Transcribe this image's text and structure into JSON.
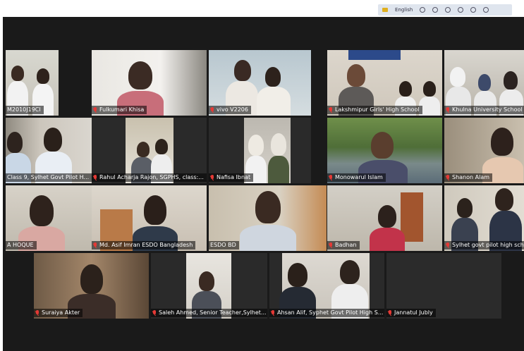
{
  "taskbar": {
    "language": "English"
  },
  "participants": [
    {
      "name": "M2010J19CI"
    },
    {
      "name": "Fulkumari Khisa"
    },
    {
      "name": "vivo V2206"
    },
    {
      "name": "Lakshmipur Girls' High School"
    },
    {
      "name": "Khulna University School"
    },
    {
      "name": "Class 9, Sylhet Govt Pilot H..."
    },
    {
      "name": "Rahul Acharja Rajon, SGPHS, class:..."
    },
    {
      "name": "Nafisa Ibnat"
    },
    {
      "name": "Monowarul Islam"
    },
    {
      "name": "Shanon Alam"
    },
    {
      "name": "A HOQUE"
    },
    {
      "name": "Md. Asif Imran ESDO Bangladesh"
    },
    {
      "name": "ESDO BD"
    },
    {
      "name": "Badhan"
    },
    {
      "name": "Sylhet govt pilot high sch"
    },
    {
      "name": "Suraiya Akter"
    },
    {
      "name": "Saleh Ahmed, Senior Teacher,Sylhet..."
    },
    {
      "name": "Ahsan Alif, Syphet Govt Pilot High S..."
    },
    {
      "name": "Jannatul Jubly"
    }
  ],
  "colors": {
    "background": "#1a1a1a",
    "active_speaker_border": "#b8e34a",
    "muted_mic": "#e53935"
  }
}
